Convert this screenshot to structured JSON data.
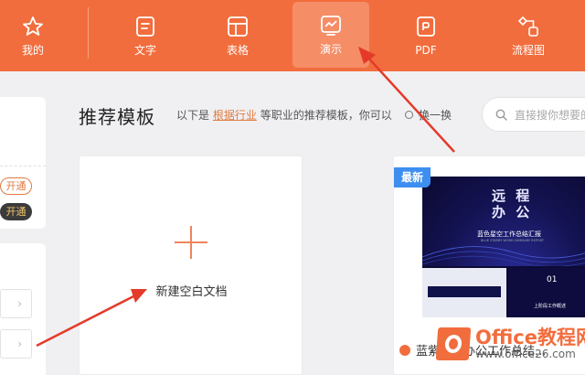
{
  "topbar": {
    "tabs": [
      {
        "label": "我的",
        "icon": "star-icon"
      },
      {
        "label": "文字",
        "icon": "document-icon"
      },
      {
        "label": "表格",
        "icon": "table-icon"
      },
      {
        "label": "演示",
        "icon": "presentation-icon",
        "active": true
      },
      {
        "label": "PDF",
        "icon": "pdf-icon"
      },
      {
        "label": "流程图",
        "icon": "flowchart-icon"
      }
    ]
  },
  "sidebar": {
    "pill_primary": "开通",
    "pill_secondary": "开通",
    "chevron": "›"
  },
  "main": {
    "section_title": "推荐模板",
    "desc_prefix": "以下是",
    "desc_link": "根据行业",
    "desc_suffix": "等职业的推荐模板，你可以",
    "swap_label": "换一换",
    "search_placeholder": "直接搜你想要的"
  },
  "new_card": {
    "label": "新建空白文档"
  },
  "template_card": {
    "badge": "最新",
    "thumb_title": "远 程\n办 公",
    "thumb_subtitle": "蓝色星空工作总结汇报",
    "thumb_caption": "BLUE STARRY WORK SUMMARY REPORT",
    "thumb_num": "01",
    "thumb_part_label": "上阶段工作概述",
    "name": "蓝紫远程办公工作总结..."
  },
  "watermark": {
    "title": "Office教程网",
    "url": "www.office26.com"
  },
  "colors": {
    "topbar": "#f26d3d",
    "accent": "#e07a3f",
    "badge": "#3d8ef0",
    "annotation": "#e53a2a"
  }
}
